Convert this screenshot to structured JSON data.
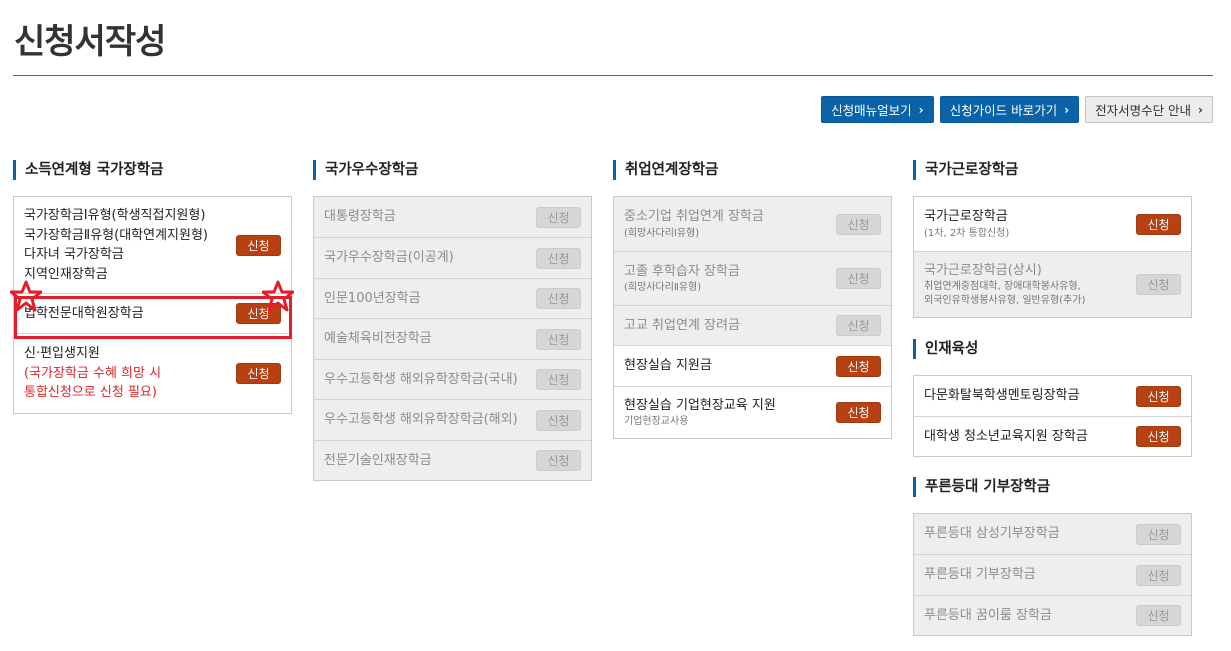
{
  "page": {
    "title": "신청서작성"
  },
  "top_buttons": [
    {
      "label": "신청매뉴얼보기",
      "icon": "chevron-right-icon",
      "style": "primary"
    },
    {
      "label": "신청가이드 바로가기",
      "icon": "chevron-right-icon",
      "style": "primary"
    },
    {
      "label": "전자서명수단 안내",
      "icon": "chevron-right-icon",
      "style": "light"
    }
  ],
  "apply_label": "신청",
  "columns": [
    {
      "heading": "소득연계형 국가장학금",
      "sections": [
        {
          "items": [
            {
              "lines": [
                "국가장학금Ⅰ유형(학생직접지원형)",
                "국가장학금Ⅱ유형(대학연계지원형)",
                "다자녀 국가장학금",
                "지역인재장학금"
              ],
              "enabled": true
            },
            {
              "lines": [
                "법학전문대학원장학금"
              ],
              "enabled": true
            },
            {
              "lines": [
                "신·편입생지원"
              ],
              "red_lines": [
                "(국가장학금 수혜 희망 시",
                "통합신청으로 신청 필요)"
              ],
              "enabled": true
            }
          ]
        }
      ]
    },
    {
      "heading": "국가우수장학금",
      "sections": [
        {
          "items": [
            {
              "lines": [
                "대통령장학금"
              ],
              "enabled": false
            },
            {
              "lines": [
                "국가우수장학금(이공계)"
              ],
              "enabled": false
            },
            {
              "lines": [
                "인문100년장학금"
              ],
              "enabled": false
            },
            {
              "lines": [
                "예술체육비전장학금"
              ],
              "enabled": false
            },
            {
              "lines": [
                "우수고등학생 해외유학장학금(국내)"
              ],
              "enabled": false
            },
            {
              "lines": [
                "우수고등학생 해외유학장학금(해외)"
              ],
              "enabled": false
            },
            {
              "lines": [
                "전문기술인재장학금"
              ],
              "enabled": false
            }
          ]
        }
      ]
    },
    {
      "heading": "취업연계장학금",
      "sections": [
        {
          "items": [
            {
              "lines": [
                "중소기업 취업연계 장학금"
              ],
              "sub": [
                "(희망사다리Ⅰ유형)"
              ],
              "enabled": false
            },
            {
              "lines": [
                "고졸 후학습자 장학금"
              ],
              "sub": [
                "(희망사다리Ⅱ유형)"
              ],
              "enabled": false
            },
            {
              "lines": [
                "고교 취업연계 장려금"
              ],
              "enabled": false
            },
            {
              "lines": [
                "현장실습 지원금"
              ],
              "enabled": true
            },
            {
              "lines": [
                "현장실습 기업현장교육 지원"
              ],
              "sub": [
                "기업현장교사용"
              ],
              "enabled": true
            }
          ]
        }
      ]
    },
    {
      "heading": "국가근로장학금",
      "sections": [
        {
          "items": [
            {
              "lines": [
                "국가근로장학금"
              ],
              "sub": [
                "(1차, 2차 통합신청)"
              ],
              "enabled": true
            },
            {
              "lines": [
                "국가근로장학금(상시)"
              ],
              "sub": [
                "취업연계중점대학, 장애대학봉사유형,",
                "외국인유학생봉사유형, 일반유형(추가)"
              ],
              "enabled": false
            }
          ]
        },
        {
          "heading": "인재육성",
          "items": [
            {
              "lines": [
                "다문화탈북학생멘토링장학금"
              ],
              "enabled": true
            },
            {
              "lines": [
                "대학생 청소년교육지원 장학금"
              ],
              "enabled": true
            }
          ]
        },
        {
          "heading": "푸른등대 기부장학금",
          "items": [
            {
              "lines": [
                "푸른등대 삼성기부장학금"
              ],
              "enabled": false
            },
            {
              "lines": [
                "푸른등대 기부장학금"
              ],
              "enabled": false
            },
            {
              "lines": [
                "푸른등대 꿈이룸 장학금"
              ],
              "enabled": false
            }
          ]
        }
      ]
    }
  ],
  "colors": {
    "primary_blue": "#0a63a8",
    "apply_active": "#b74112",
    "apply_inactive": "#d6d6d6",
    "highlight_red": "#e31e2a"
  }
}
